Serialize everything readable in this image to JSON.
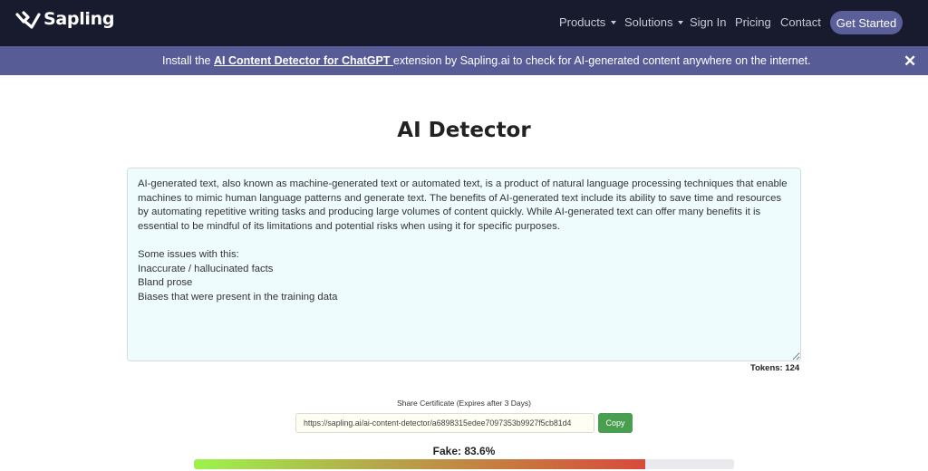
{
  "navbar": {
    "brand": "Sapling",
    "items": [
      {
        "label": "Products",
        "dropdown": true
      },
      {
        "label": "Solutions",
        "dropdown": true
      },
      {
        "label": "Sign In",
        "dropdown": false
      },
      {
        "label": "Pricing",
        "dropdown": false
      },
      {
        "label": "Contact",
        "dropdown": false
      }
    ],
    "cta_label": "Get Started"
  },
  "banner": {
    "prefix": "Install the ",
    "link_text": "AI Content Detector for ChatGPT ",
    "suffix": " extension by Sapling.ai to check for AI-generated content anywhere on the internet.",
    "close_icon": "close-icon"
  },
  "page": {
    "title": "AI Detector",
    "input_text": "AI-generated text, also known as machine-generated text or automated text, is a product of natural language processing techniques that enable machines to mimic human language patterns and generate text. The benefits of AI-generated text include its ability to save time and resources by automating repetitive writing tasks and producing large volumes of content quickly. While AI-generated text can offer many benefits it is essential to be mindful of its limitations and potential risks when using it for specific purposes.\n\nSome issues with this:\nInaccurate / hallucinated facts\nBland prose\nBiases that were present in the training data",
    "tokens_label": "Tokens: 124",
    "share_label": "Share Certificate (Expires after 3 Days)",
    "share_url": "https://sapling.ai/ai-content-detector/a6898315edee7097353b9927f5cb81d4",
    "copy_label": "Copy",
    "fake_label": "Fake: 83.6%",
    "fake_percent": 83.6
  },
  "colors": {
    "navbar_bg": "#181a2e",
    "banner_bg": "#575c96",
    "cta_bg": "#5a5f99",
    "copy_bg": "#4a9e4f",
    "textarea_bg": "#effcfe"
  }
}
